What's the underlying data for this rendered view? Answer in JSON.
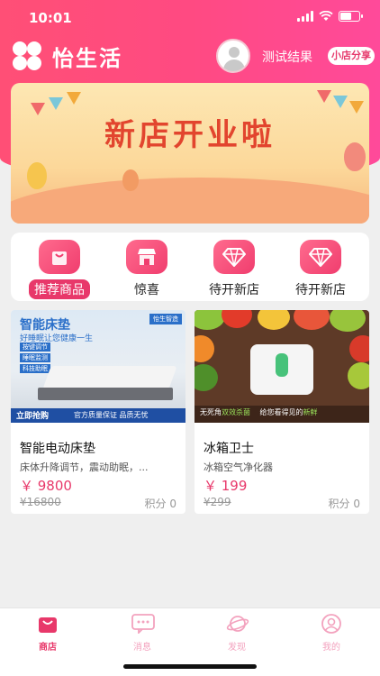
{
  "status_bar": {
    "time": "10:01"
  },
  "header": {
    "app_title": "怡生活",
    "test_result_label": "测试结果",
    "share_label": "小店分享"
  },
  "banner": {
    "title": "新店开业啦"
  },
  "quick_nav": [
    {
      "label": "推荐商品",
      "icon": "shopping-bag-icon",
      "active": true
    },
    {
      "label": "惊喜",
      "icon": "store-icon",
      "active": false
    },
    {
      "label": "待开新店",
      "icon": "diamond-icon",
      "active": false
    },
    {
      "label": "待开新店",
      "icon": "diamond-icon",
      "active": false
    }
  ],
  "products": [
    {
      "name": "智能电动床垫",
      "description": "床体升降调节，震动助眠，...",
      "price": "￥ 9800",
      "original_price": "¥16800",
      "points": "积分 0",
      "image": {
        "title": "智能床垫",
        "subtitle": "好睡眠让您健康一生",
        "brand": "怡生智造",
        "tags": [
          "按键调节",
          "睡眠监测",
          "科技助眠"
        ],
        "cta": "立即抢购",
        "slogan": "官方质量保证 品质无忧"
      }
    },
    {
      "name": "冰箱卫士",
      "description": "冰箱空气净化器",
      "price": "￥ 199",
      "original_price": "¥299",
      "points": "积分 0",
      "image": {
        "caption_left": "无死角",
        "caption_highlight": "双效杀菌",
        "caption_right": "给您看得见的",
        "caption_end": "新鲜"
      }
    }
  ],
  "tabbar": [
    {
      "label": "商店",
      "icon": "shop-bag-icon",
      "active": true
    },
    {
      "label": "消息",
      "icon": "message-icon",
      "active": false
    },
    {
      "label": "发现",
      "icon": "planet-icon",
      "active": false
    },
    {
      "label": "我的",
      "icon": "profile-icon",
      "active": false
    }
  ],
  "colors": {
    "brand": "#e8386a",
    "header_gradient_start": "#ff4f76",
    "header_gradient_end": "#ff4a9a"
  }
}
